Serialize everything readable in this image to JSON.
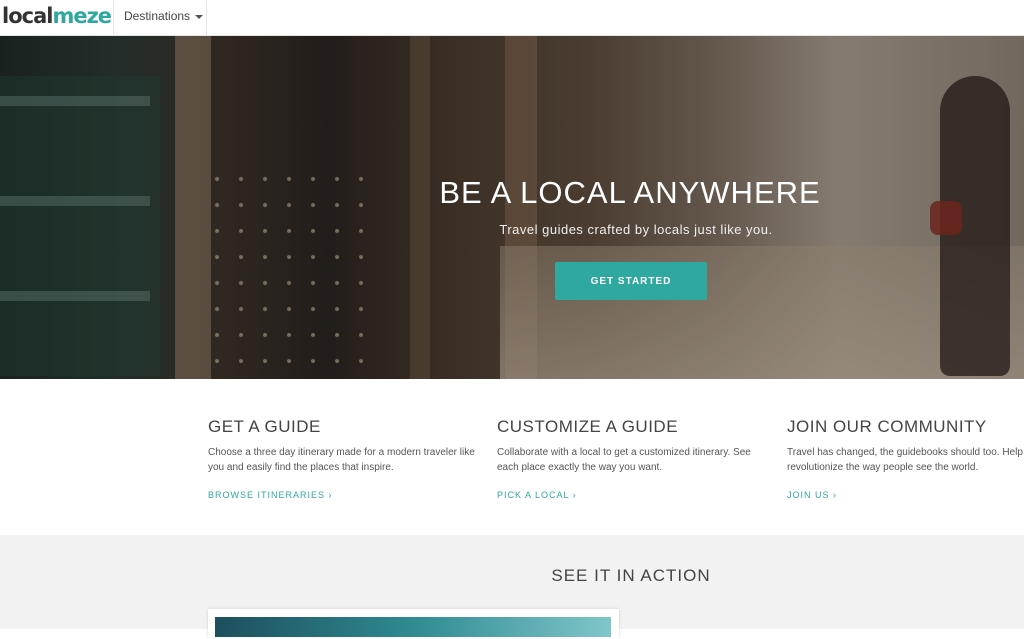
{
  "nav": {
    "logo_part1": "local",
    "logo_part2": "meze",
    "destinations_label": "Destinations"
  },
  "hero": {
    "title": "BE A LOCAL ANYWHERE",
    "subtitle": "Travel guides crafted by locals just like you.",
    "cta_label": "GET STARTED"
  },
  "features": [
    {
      "title": "GET A GUIDE",
      "text": "Choose a three day itinerary made for a modern traveler like you and easily find the places that inspire.",
      "link": "BROWSE ITINERARIES ›"
    },
    {
      "title": "CUSTOMIZE A GUIDE",
      "text": "Collaborate with a local to get a customized itinerary. See each place exactly the way you want.",
      "link": "PICK A LOCAL ›"
    },
    {
      "title": "JOIN OUR COMMUNITY",
      "text": "Travel has changed, the guidebooks should too. Help us revolutionize the way people see the world.",
      "link": "JOIN US ›"
    }
  ],
  "action": {
    "title": "SEE IT IN ACTION"
  },
  "colors": {
    "accent": "#2fa8a0",
    "text": "#444444",
    "section_bg": "#f2f2f2"
  }
}
